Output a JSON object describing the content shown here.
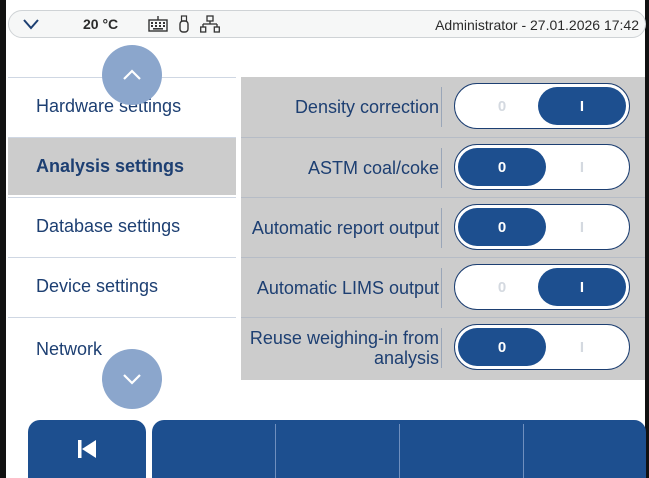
{
  "statusbar": {
    "expand_icon": "chevron-down-icon",
    "temperature": "20 °C",
    "icons": [
      "keyboard-icon",
      "usb-stick-icon",
      "network-icon"
    ],
    "user_datetime": "Administrator - 27.01.2026 17:42"
  },
  "menu": {
    "items": [
      {
        "label": "Hardware settings",
        "active": false
      },
      {
        "label": "Analysis settings",
        "active": true
      },
      {
        "label": "Database settings",
        "active": false
      },
      {
        "label": "Device settings",
        "active": false
      },
      {
        "label": "Network",
        "active": false
      }
    ],
    "scroll_up_icon": "chevron-up-icon",
    "scroll_down_icon": "chevron-down-icon"
  },
  "settings": {
    "off_label": "0",
    "on_label": "I",
    "rows": [
      {
        "label": "Density correction",
        "state": "I"
      },
      {
        "label": "ASTM coal/coke",
        "state": "0"
      },
      {
        "label": "Automatic report output",
        "state": "0"
      },
      {
        "label": "Automatic LIMS output",
        "state": "I"
      },
      {
        "label": "Reuse weighing-in from analysis",
        "state": "0"
      }
    ]
  },
  "toolbar": {
    "back_icon": "skip-back-icon"
  },
  "colors": {
    "primary": "#1d4f8f",
    "text": "#1d3f72",
    "panel_bg": "#cccccc",
    "scroll_circle": "#8ba6cc"
  }
}
